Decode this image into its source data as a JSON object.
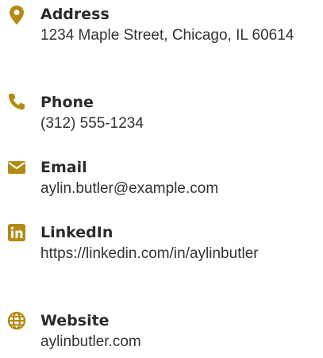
{
  "colors": {
    "icon": "#b38a12",
    "label": "#2b2b2b",
    "value": "#333333"
  },
  "contacts": [
    {
      "icon": "map-pin-icon",
      "label": "Address",
      "value": "1234 Maple Street, Chicago, IL 60614"
    },
    {
      "icon": "phone-icon",
      "label": "Phone",
      "value": "(312) 555-1234"
    },
    {
      "icon": "envelope-icon",
      "label": "Email",
      "value": "aylin.butler@example.com"
    },
    {
      "icon": "linkedin-icon",
      "label": "LinkedIn",
      "value": "https://linkedin.com/in/aylinbutler"
    },
    {
      "icon": "globe-icon",
      "label": "Website",
      "value": "aylinbutler.com"
    }
  ]
}
